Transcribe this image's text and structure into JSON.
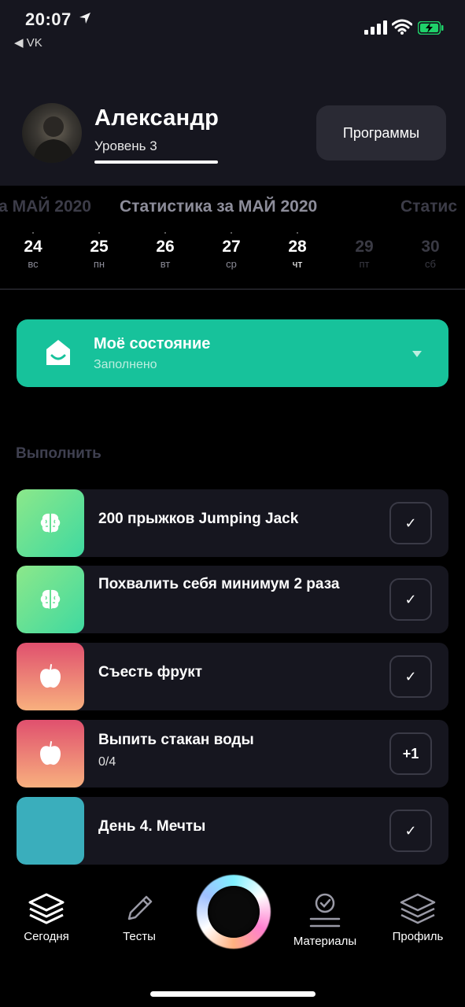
{
  "status_bar": {
    "time": "20:07",
    "back_app": "◀ VK"
  },
  "profile": {
    "name": "Александр",
    "level": "Уровень 3",
    "level_progress": 1.0,
    "programs_button": "Программы"
  },
  "stats": {
    "title_prev": "за МАЙ 2020",
    "title": "Статистика за МАЙ 2020",
    "title_next": "Статис",
    "days": [
      {
        "num": "24",
        "weekday": "вс"
      },
      {
        "num": "25",
        "weekday": "пн"
      },
      {
        "num": "26",
        "weekday": "вт"
      },
      {
        "num": "27",
        "weekday": "ср"
      },
      {
        "num": "28",
        "weekday": "чт"
      },
      {
        "num": "29",
        "weekday": "пт"
      },
      {
        "num": "30",
        "weekday": "сб"
      }
    ]
  },
  "state_card": {
    "title": "Моё состояние",
    "subtitle": "Заполнено"
  },
  "section_title": "Выполнить",
  "tasks": [
    {
      "title": "200 прыжков Jumping Jack",
      "progress": "",
      "action": "✓",
      "icon": "brain-icon"
    },
    {
      "title": "Похвалить себя минимум 2 раза",
      "progress": "",
      "action": "✓",
      "icon": "brain-icon"
    },
    {
      "title": "Съесть фрукт",
      "progress": "",
      "action": "✓",
      "icon": "apple-icon"
    },
    {
      "title": "Выпить стакан воды",
      "progress": "0/4",
      "action": "+1",
      "icon": "apple-icon"
    },
    {
      "title": "День 4. Мечты",
      "progress": "",
      "action": "✓",
      "icon": ""
    }
  ],
  "tabbar": {
    "today": "Сегодня",
    "tests": "Тесты",
    "materials": "Материалы",
    "profile": "Профиль"
  },
  "colors": {
    "accent_green": "#17c29b",
    "card_bg": "#16161f",
    "brain_gradient": [
      "#8ce88a",
      "#3fd9a0"
    ],
    "apple_gradient": [
      "#e0506e",
      "#f8b07e"
    ],
    "teal": "#3aaebc"
  }
}
